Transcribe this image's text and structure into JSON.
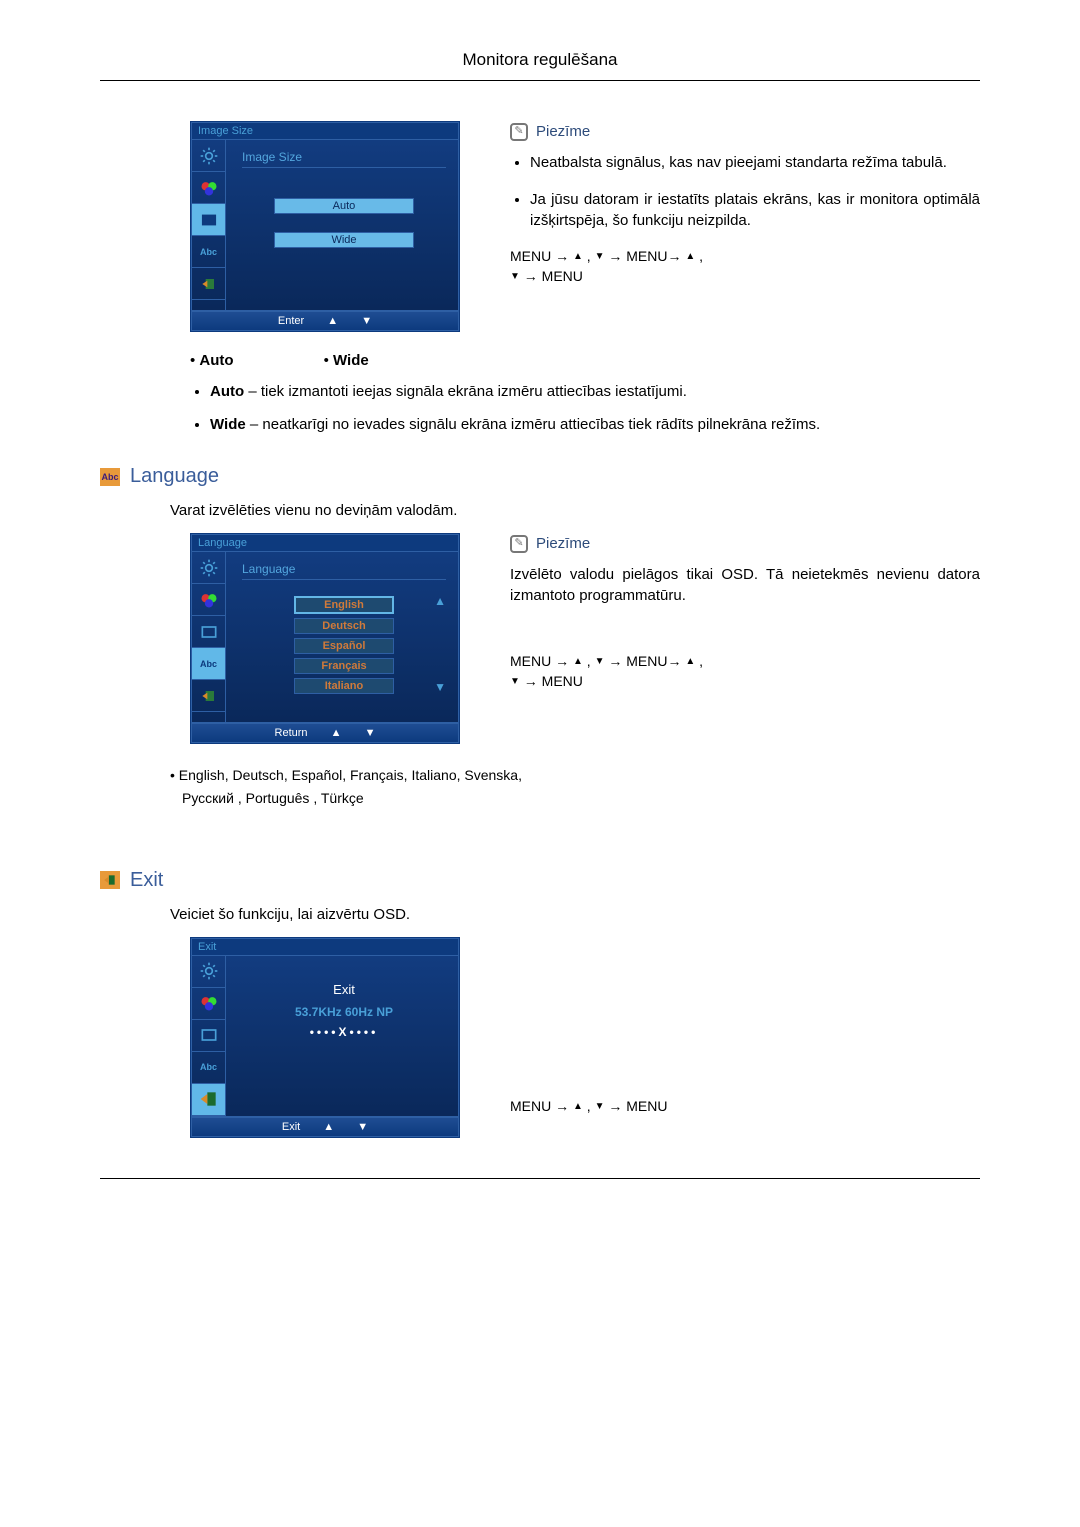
{
  "header": {
    "title": "Monitora regulēšana"
  },
  "osd_image_size": {
    "title": "Image Size",
    "content_title": "Image Size",
    "option_auto": "Auto",
    "option_wide": "Wide",
    "footer_action": "Enter"
  },
  "note1": {
    "label": "Piezīme",
    "bullet1": "Neatbalsta signālus, kas nav pieejami standarta re­žīma tabulā.",
    "bullet2": "Ja jūsu datoram ir iestatīts platais ekrāns, kas ir moni­tora optimālā izšķirtspēja, šo funkciju neizpilda.",
    "nav_seq_part1": "MENU → ",
    "nav_seq_part2": " , ",
    "nav_seq_part3": " → MENU→ ",
    "nav_seq_part4": " , ",
    "nav_seq_part5": " → MENU"
  },
  "options_row": {
    "auto": "Auto",
    "wide": "Wide"
  },
  "explain": {
    "auto_label": "Auto",
    "auto_text": " – tiek izmantoti ieejas signāla ekrāna izmēru attiecības iestatījumi.",
    "wide_label": "Wide",
    "wide_text": " – neatkarīgi no ievades signālu ekrāna izmēru attiecības tiek rādīts pilnekrāna re­žīms."
  },
  "section_language": {
    "title": "Language",
    "intro": "Varat izvēlēties vienu no deviņām valodām."
  },
  "osd_language": {
    "title": "Language",
    "content_title": "Language",
    "opt1": "English",
    "opt2": "Deutsch",
    "opt3": "Español",
    "opt4": "Français",
    "opt5": "Italiano",
    "footer_action": "Return"
  },
  "note2": {
    "label": "Piezīme",
    "text": "Izvēlēto valodu pielāgos tikai OSD. Tā neietekmēs nevienu datora izmantoto programma­tūru.",
    "nav_seq_part1": "MENU → ",
    "nav_seq_part2": " , ",
    "nav_seq_part3": " → MENU→ ",
    "nav_seq_part4": " , ",
    "nav_seq_part5": " → MENU"
  },
  "lang_list": {
    "line1": "• English, Deutsch, Español, Français,  Italiano, Svenska,",
    "line2": "Русский , Português , Türkçe"
  },
  "section_exit": {
    "title": "Exit",
    "intro": "Veiciet šo funkciju, lai aizvērtu OSD."
  },
  "osd_exit": {
    "title": "Exit",
    "content_title": "Exit",
    "info": "53.7KHz 60Hz NP",
    "xline": "••••X••••",
    "footer_action": "Exit"
  },
  "exit_nav": {
    "part1": "MENU → ",
    "part2": " , ",
    "part3": " → MENU"
  }
}
